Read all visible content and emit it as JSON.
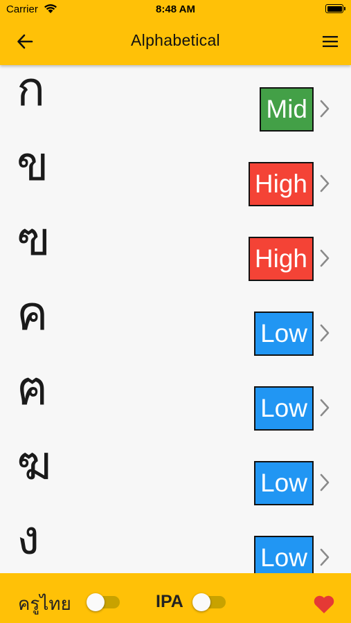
{
  "status_bar": {
    "carrier": "Carrier",
    "time": "8:48 AM"
  },
  "header": {
    "title": "Alphabetical",
    "back_icon": "arrow-left-icon",
    "menu_icon": "hamburger-menu-icon"
  },
  "colors": {
    "accent": "#ffc107",
    "mid": "#43a047",
    "high": "#f44336",
    "low": "#2196f3"
  },
  "letters": [
    {
      "char": "ก",
      "class": "Mid"
    },
    {
      "char": "ข",
      "class": "High"
    },
    {
      "char": "ฃ",
      "class": "High"
    },
    {
      "char": "ค",
      "class": "Low"
    },
    {
      "char": "ฅ",
      "class": "Low"
    },
    {
      "char": "ฆ",
      "class": "Low"
    },
    {
      "char": "ง",
      "class": "Low"
    }
  ],
  "footer": {
    "thai_teacher_label": "ครูไทย",
    "thai_teacher_on": false,
    "ipa_label": "IPA",
    "ipa_on": false,
    "favorite_icon": "heart-icon"
  }
}
